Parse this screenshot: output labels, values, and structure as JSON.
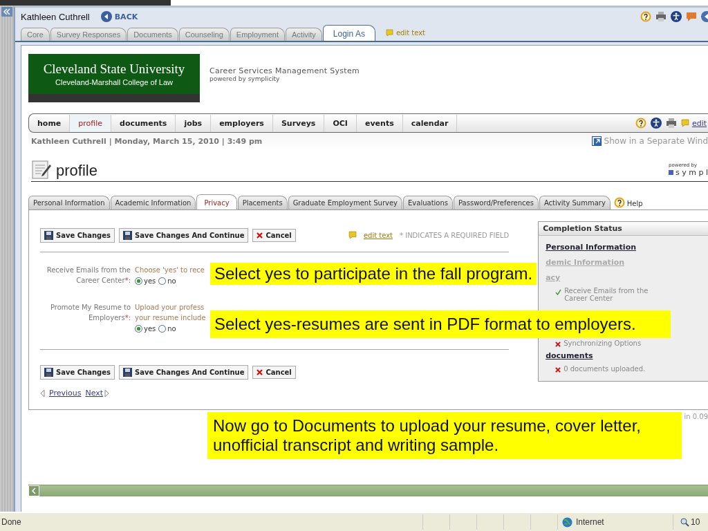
{
  "top_header": {
    "name": "Kathleen Cuthrell",
    "back": "BACK",
    "edit_text": "edit text",
    "tabs": [
      {
        "label": "Core",
        "selected": false
      },
      {
        "label": "Survey Responses",
        "selected": false
      },
      {
        "label": "Documents",
        "selected": false
      },
      {
        "label": "Counseling",
        "selected": false
      },
      {
        "label": "Employment",
        "selected": false
      },
      {
        "label": "Activity",
        "selected": false
      },
      {
        "label": "Login As",
        "selected": true
      }
    ]
  },
  "logo": {
    "title": "Cleveland State University",
    "subtitle": "Cleveland-Marshall College of Law"
  },
  "system": {
    "title": "Career Services Management System",
    "powered": "powered by symplicity"
  },
  "nav": {
    "edit_link": "edit",
    "items": [
      {
        "label": "home",
        "selected": false
      },
      {
        "label": "profile",
        "selected": true
      },
      {
        "label": "documents",
        "selected": false
      },
      {
        "label": "jobs",
        "selected": false
      },
      {
        "label": "employers",
        "selected": false
      },
      {
        "label": "Surveys",
        "selected": false
      },
      {
        "label": "OCI",
        "selected": false
      },
      {
        "label": "events",
        "selected": false
      },
      {
        "label": "calendar",
        "selected": false
      }
    ]
  },
  "info_line": "Kathleen Cuthrell | Monday, March 15, 2010 | 3:49 pm",
  "separate_window": "Show in a Separate Wind",
  "powered_by": {
    "label": "powered by",
    "brand": "s y m p l"
  },
  "heading": "profile",
  "profile_tabs": [
    {
      "label": "Personal Information",
      "selected": false
    },
    {
      "label": "Academic Information",
      "selected": false
    },
    {
      "label": "Privacy",
      "selected": true
    },
    {
      "label": "Placements",
      "selected": false
    },
    {
      "label": "Graduate Employment Survey",
      "selected": false
    },
    {
      "label": "Evaluations",
      "selected": false
    },
    {
      "label": "Password/Preferences",
      "selected": false
    },
    {
      "label": "Activity Summary",
      "selected": false
    }
  ],
  "help": "Help",
  "top_buttons": [
    {
      "label": "Save Changes",
      "kind": "save"
    },
    {
      "label": "Save Changes And Continue",
      "kind": "save"
    },
    {
      "label": "Cancel",
      "kind": "cancel"
    }
  ],
  "required_note": {
    "edit_text": "edit text",
    "note": "* INDICATES A REQUIRED FIELD"
  },
  "fields": [
    {
      "label": "Receive Emails from the Career Center",
      "required_mark": "*",
      "suffix": ":",
      "hint_lines": [
        "Choose 'yes' to rece"
      ],
      "options": [
        {
          "label": "yes",
          "selected": true
        },
        {
          "label": "no",
          "selected": false
        }
      ]
    },
    {
      "label": "Promote My Resume to Employers",
      "required_mark": "*",
      "suffix": ":",
      "hint_lines": [
        "Upload your profess",
        "your resume include"
      ],
      "options": [
        {
          "label": "yes",
          "selected": true
        },
        {
          "label": "no",
          "selected": false
        }
      ]
    }
  ],
  "bottom_buttons": [
    {
      "label": "Save Changes",
      "kind": "save"
    },
    {
      "label": "Save Changes And Continue",
      "kind": "save"
    },
    {
      "label": "Cancel",
      "kind": "cancel"
    }
  ],
  "pager": {
    "previous": "Previous",
    "next": "Next"
  },
  "completion_status": {
    "title": "Completion Status",
    "sections": [
      {
        "label": "Personal Information",
        "muted": false
      },
      {
        "label": "demic Information",
        "muted": true
      },
      {
        "label": "acy",
        "muted": true,
        "items": [
          {
            "label": "Receive Emails from the Career Center",
            "done": true
          },
          {
            "label": "Synchronizing Options",
            "done": false
          }
        ]
      },
      {
        "label": "documents",
        "muted": false,
        "items": [
          {
            "label": "0 documents uploaded.",
            "done": false
          }
        ]
      }
    ]
  },
  "footer_note": "in 0.09",
  "callouts": [
    "Select yes to participate in the fall program.",
    "Select yes-resumes are sent in PDF format to employers.",
    "Now go to Documents to upload your resume, cover letter, unofficial transcript and writing sample."
  ],
  "status_bar": {
    "status": "Done",
    "zone": "Internet",
    "zoom": "10"
  }
}
